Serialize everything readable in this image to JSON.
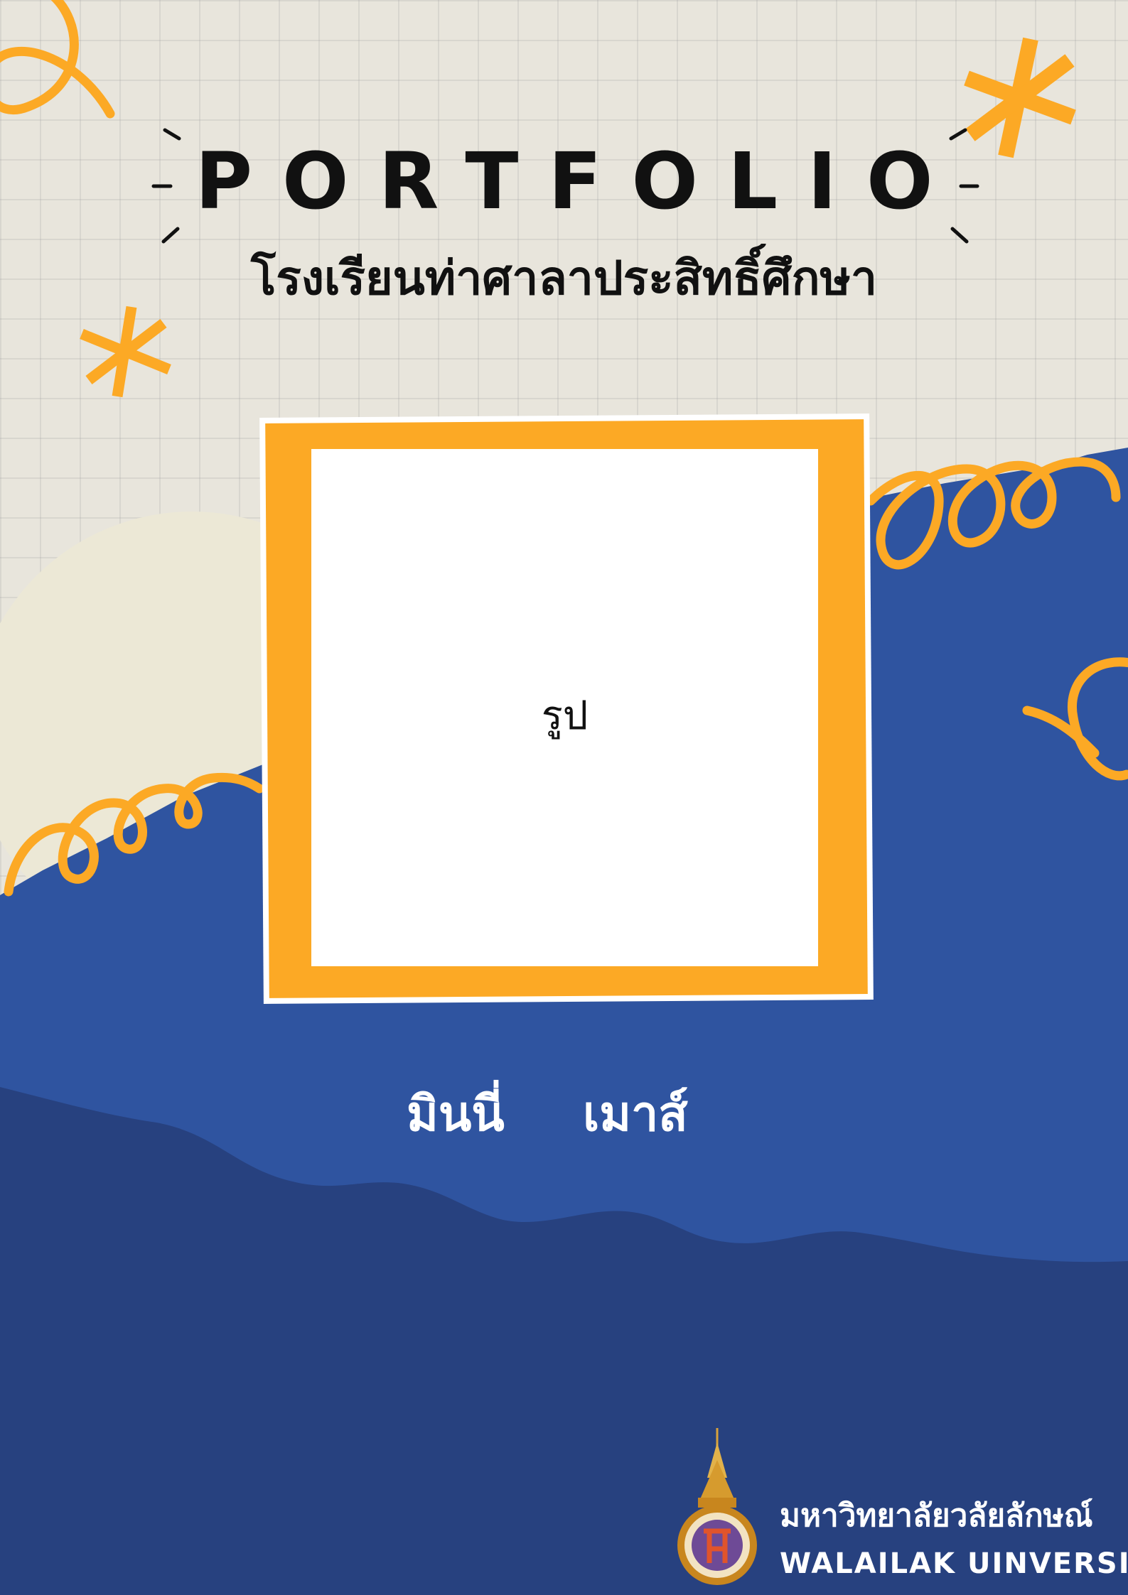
{
  "cover": {
    "title": "PORTFOLIO",
    "school": "โรงเรียนท่าศาลาประสิทธิ์ศึกษา",
    "photo_placeholder": "รูป",
    "first_name": "มินนี่",
    "last_name": "เมาส์"
  },
  "university": {
    "name_th": "มหาวิทยาลัยวลัยลักษณ์",
    "name_en": "WALAILAK UINVERSITY",
    "logo_icon": "university-seal-icon"
  },
  "colors": {
    "accent_orange": "#fca925",
    "blue": "#2f54a0",
    "dark_blue": "#27417f",
    "paper": "#e8e5dc",
    "cream": "#ece8d6"
  }
}
